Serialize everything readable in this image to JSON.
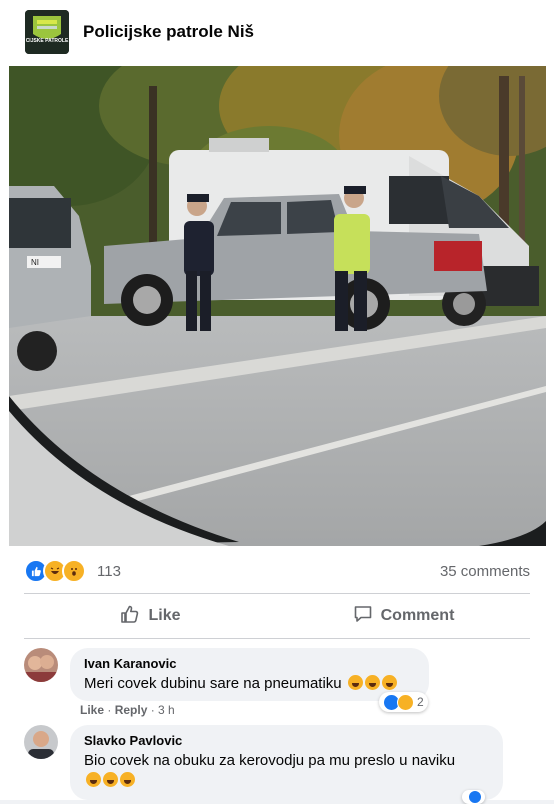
{
  "post": {
    "page_name": "Policijske patrole Niš",
    "avatar_text": "CIJSKE PATROLE",
    "plate_text": "NI"
  },
  "stats": {
    "reactions_count": "113",
    "comments_count": "35 comments"
  },
  "actions": {
    "like_label": "Like",
    "comment_label": "Comment"
  },
  "comments": [
    {
      "name": "Ivan Karanovic",
      "text": "Meri covek dubinu sare na pneumatiku",
      "like_label": "Like",
      "reply_label": "Reply",
      "time": "3 h",
      "reaction_count": "2"
    },
    {
      "name": "Slavko Pavlovic",
      "text": "Bio covek na obuku za kerovodju pa mu preslo u naviku"
    }
  ],
  "colors": {
    "like_blue": "#1877f2",
    "haha_yellow": "#f7b125",
    "text_secondary": "#65676b"
  },
  "icons": [
    "like-reaction-icon",
    "haha-reaction-icon",
    "wow-reaction-icon",
    "thumbs-up-icon",
    "comment-icon",
    "laughing-emoji-icon"
  ]
}
